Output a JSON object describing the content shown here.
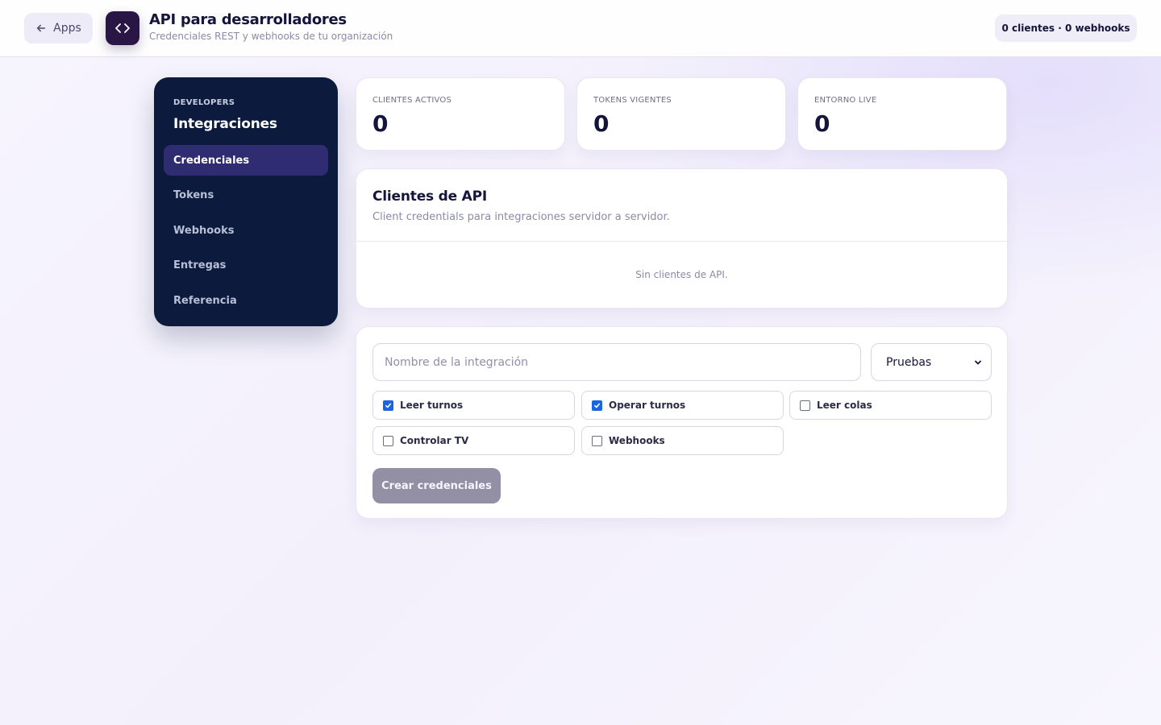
{
  "header": {
    "back_label": "Apps",
    "title": "API para desarrolladores",
    "subtitle": "Credenciales REST y webhooks de tu organización",
    "summary": "0 clientes · 0 webhooks"
  },
  "sidebar": {
    "eyebrow": "DEVELOPERS",
    "title": "Integraciones",
    "items": [
      {
        "label": "Credenciales",
        "active": true
      },
      {
        "label": "Tokens",
        "active": false
      },
      {
        "label": "Webhooks",
        "active": false
      },
      {
        "label": "Entregas",
        "active": false
      },
      {
        "label": "Referencia",
        "active": false
      }
    ]
  },
  "stats": [
    {
      "label": "CLIENTES ACTIVOS",
      "value": "0"
    },
    {
      "label": "TOKENS VIGENTES",
      "value": "0"
    },
    {
      "label": "ENTORNO LIVE",
      "value": "0"
    }
  ],
  "clients": {
    "title": "Clientes de API",
    "subtitle": "Client credentials para integraciones servidor a servidor.",
    "empty": "Sin clientes de API."
  },
  "form": {
    "name_placeholder": "Nombre de la integración",
    "name_value": "",
    "environment": "Pruebas",
    "scopes": [
      {
        "label": "Leer turnos",
        "checked": true
      },
      {
        "label": "Operar turnos",
        "checked": true
      },
      {
        "label": "Leer colas",
        "checked": false
      },
      {
        "label": "Controlar TV",
        "checked": false
      },
      {
        "label": "Webhooks",
        "checked": false
      }
    ],
    "submit_label": "Crear credenciales"
  },
  "colors": {
    "sidebar_bg": "#0b1a3d",
    "active_item": "#2f2c72",
    "checkbox_checked": "#1a66e0",
    "disabled_button": "#9390a6"
  }
}
